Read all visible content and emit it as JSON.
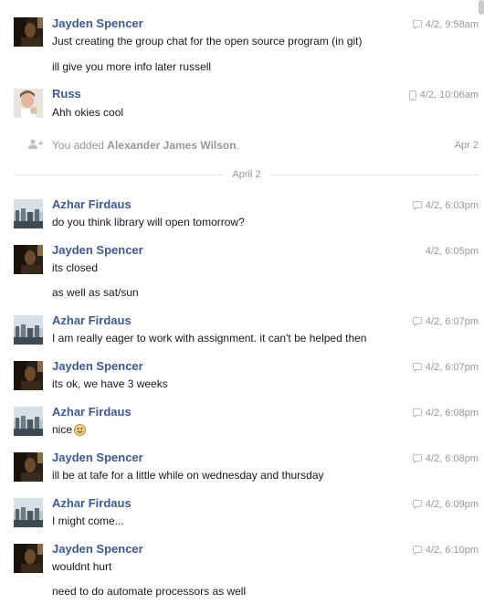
{
  "messages_1": {
    "jayden_1": {
      "sender": "Jayden Spencer",
      "time": "4/2, 9:58am",
      "lines": [
        "Just creating the group chat for the open source program (in git)",
        "ill give you more info later russell"
      ]
    },
    "russ_1": {
      "sender": "Russ",
      "time": "4/2, 10:06am",
      "lines": [
        "Ahh okies cool"
      ]
    }
  },
  "system_event": {
    "prefix": "You added ",
    "name": "Alexander James Wilson",
    "suffix": ".",
    "date": "Apr 2"
  },
  "divider_label": "April 2",
  "messages_2": [
    {
      "sender": "Azhar Firdaus",
      "time": "4/2, 6:03pm",
      "icon": "chat-bubble-icon",
      "lines": [
        "do you think library will open tomorrow?"
      ]
    },
    {
      "sender": "Jayden Spencer",
      "time": "4/2, 6:05pm",
      "icon": "",
      "lines": [
        "its closed",
        "as well as sat/sun"
      ]
    },
    {
      "sender": "Azhar Firdaus",
      "time": "4/2, 6:07pm",
      "icon": "chat-bubble-icon",
      "lines": [
        "I am really eager to work with assignment. it can't be helped then"
      ]
    },
    {
      "sender": "Jayden Spencer",
      "time": "4/2, 6:07pm",
      "icon": "chat-bubble-icon",
      "lines": [
        "its ok, we have 3 weeks"
      ]
    },
    {
      "sender": "Azhar Firdaus",
      "time": "4/2, 6:08pm",
      "icon": "chat-bubble-icon",
      "lines": [
        "nice"
      ]
    },
    {
      "sender": "Jayden Spencer",
      "time": "4/2, 6:08pm",
      "icon": "chat-bubble-icon",
      "lines": [
        "ill be at tafe for a little while on wednesday and thursday"
      ]
    },
    {
      "sender": "Azhar Firdaus",
      "time": "4/2, 6:09pm",
      "icon": "chat-bubble-icon",
      "lines": [
        "I might come..."
      ]
    },
    {
      "sender": "Jayden Spencer",
      "time": "4/2, 6:10pm",
      "icon": "chat-bubble-icon",
      "lines": [
        "wouldnt hurt",
        "need to do automate processors as well"
      ]
    }
  ],
  "colors": {
    "sender": "#3b5998",
    "meta": "#9197a3",
    "text": "#141823",
    "divider": "#e5e5e5"
  }
}
